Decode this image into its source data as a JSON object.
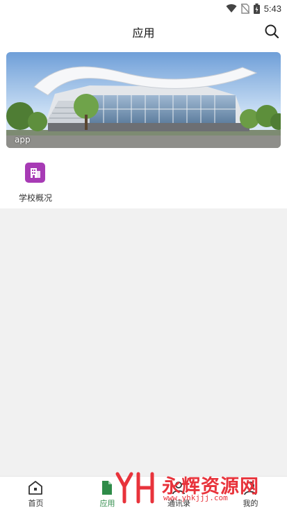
{
  "status_bar": {
    "time": "5:43",
    "icons": [
      "wifi-icon",
      "no-sim-icon",
      "battery-icon"
    ]
  },
  "header": {
    "title": "应用",
    "search_icon": "search-icon"
  },
  "banner": {
    "caption": "app"
  },
  "apps": [
    {
      "label": "学校概况",
      "icon": "building-icon",
      "color": "#a73bb5"
    }
  ],
  "bottom_nav": {
    "items": [
      {
        "label": "首页",
        "icon": "home-icon",
        "active": false
      },
      {
        "label": "应用",
        "icon": "document-icon",
        "active": true
      },
      {
        "label": "通讯录",
        "icon": "contacts-icon",
        "active": false
      },
      {
        "label": "我的",
        "icon": "profile-icon",
        "active": false
      }
    ],
    "active_color": "#2e8b48"
  },
  "watermark": {
    "brand": "永辉资源网",
    "url": "www.yhkjjj.com",
    "color": "#e8333b"
  }
}
